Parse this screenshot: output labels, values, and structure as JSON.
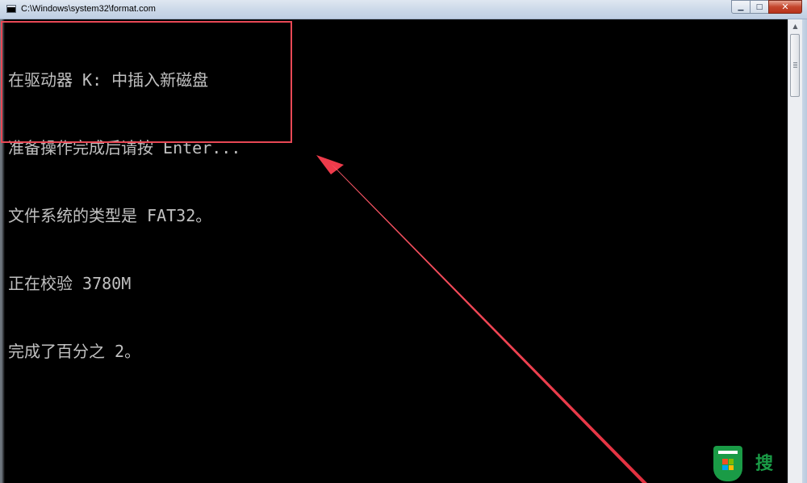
{
  "window": {
    "title": "C:\\Windows\\system32\\format.com",
    "buttons": {
      "minimize": "▁",
      "maximize": "□",
      "close": "✕"
    },
    "icon": "console-icon"
  },
  "console": {
    "lines": [
      "在驱动器 K: 中插入新磁盘",
      "准备操作完成后请按 Enter...",
      "文件系统的类型是 FAT32。",
      "正在校验 3780M",
      "完成了百分之 2。"
    ],
    "text_color": "#c0c0c0",
    "background": "#000000"
  },
  "annotation": {
    "color": "#e84855",
    "type": "highlight-box-with-arrow"
  },
  "watermark": {
    "text": "搜",
    "brand_color": "#1a9b46",
    "logo": "windows-logo"
  }
}
